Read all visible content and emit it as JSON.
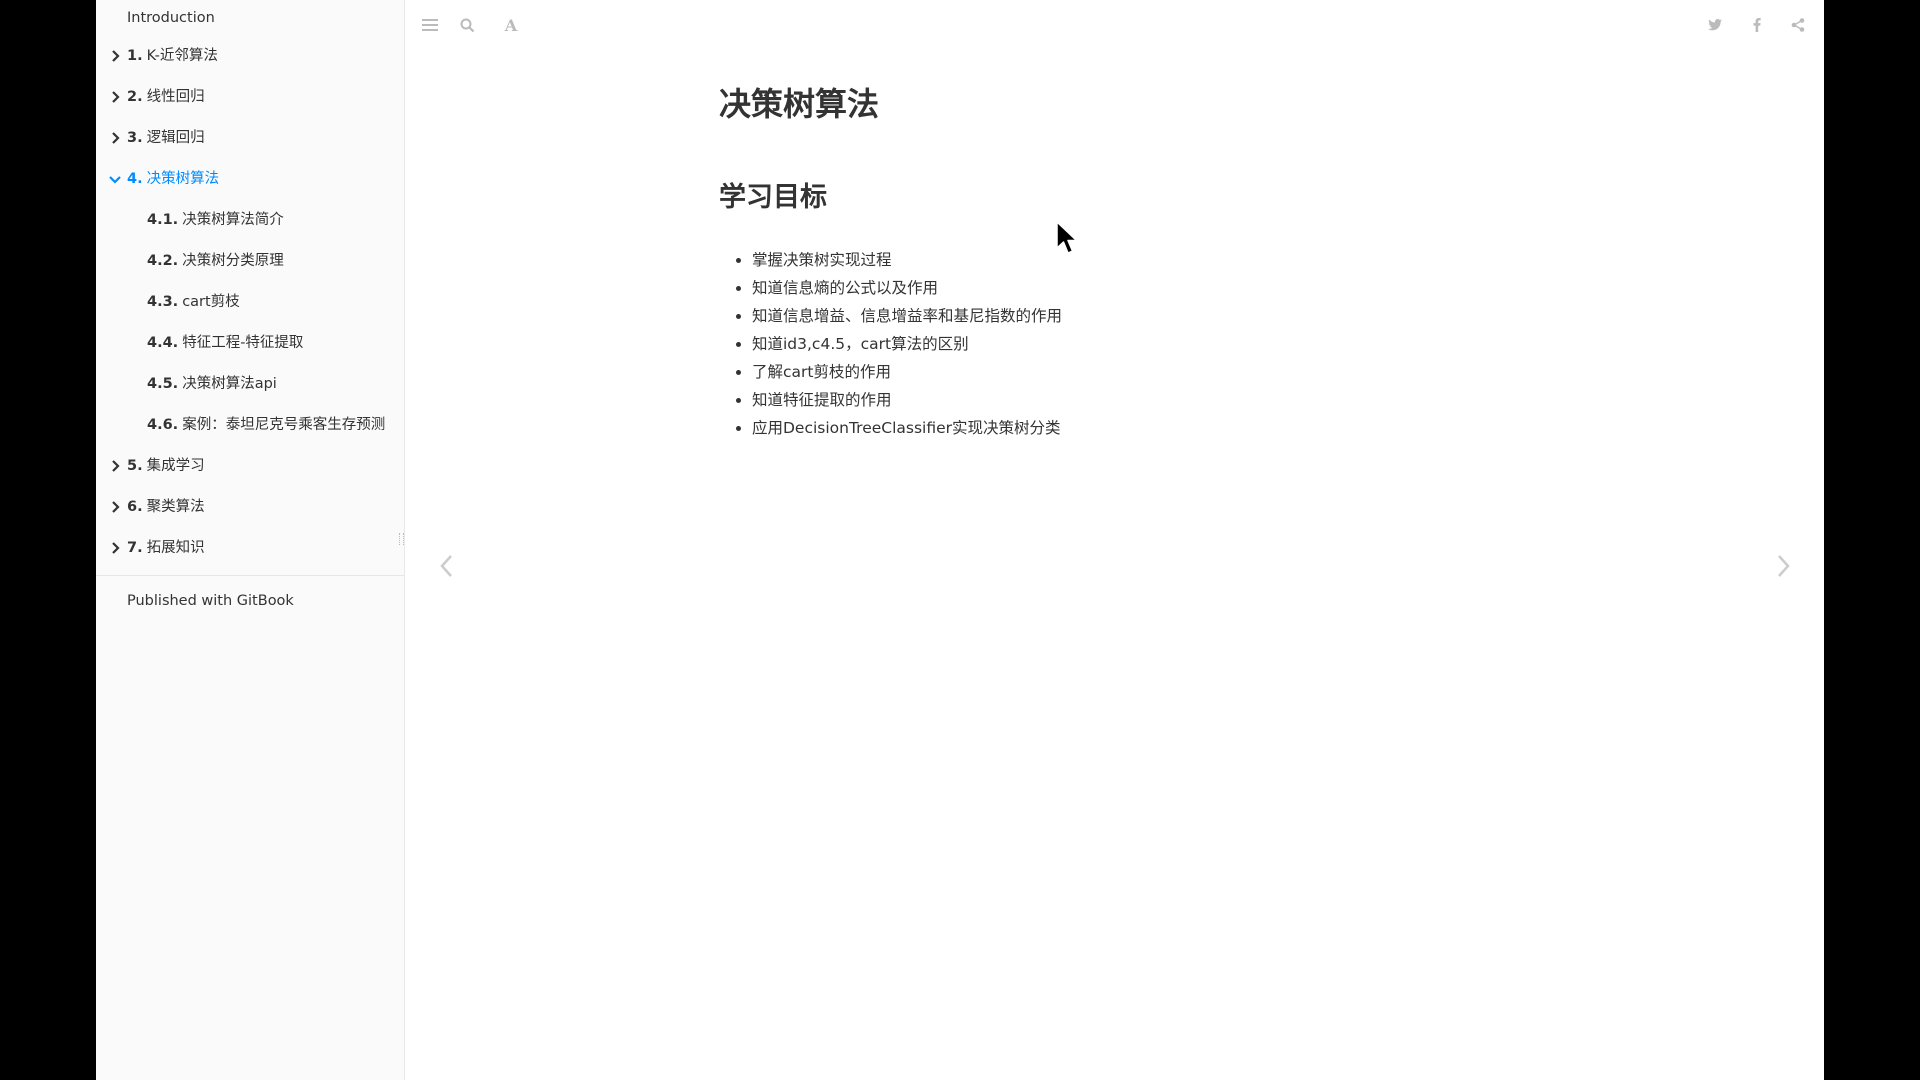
{
  "sidebar": {
    "intro": "Introduction",
    "chapters": [
      {
        "num": "1.",
        "label": "K-近邻算法"
      },
      {
        "num": "2.",
        "label": "线性回归"
      },
      {
        "num": "3.",
        "label": "逻辑回归"
      },
      {
        "num": "4.",
        "label": "决策树算法"
      },
      {
        "num": "5.",
        "label": "集成学习"
      },
      {
        "num": "6.",
        "label": "聚类算法"
      },
      {
        "num": "7.",
        "label": "拓展知识"
      }
    ],
    "sub_items": [
      {
        "num": "4.1.",
        "label": "决策树算法简介"
      },
      {
        "num": "4.2.",
        "label": "决策树分类原理"
      },
      {
        "num": "4.3.",
        "label": "cart剪枝"
      },
      {
        "num": "4.4.",
        "label": "特征工程-特征提取"
      },
      {
        "num": "4.5.",
        "label": "决策树算法api"
      },
      {
        "num": "4.6.",
        "label": "案例：泰坦尼克号乘客生存预测"
      }
    ],
    "published": "Published with GitBook",
    "active_color": "#008cff"
  },
  "toolbar": {
    "icons": [
      "menu-icon",
      "search-icon",
      "font-settings-icon",
      "twitter-icon",
      "facebook-icon",
      "share-icon"
    ]
  },
  "article": {
    "title": "决策树算法",
    "section_heading": "学习目标",
    "goals": [
      "掌握决策树实现过程",
      "知道信息熵的公式以及作用",
      "知道信息增益、信息增益率和基尼指数的作用",
      "知道id3,c4.5，cart算法的区别",
      "了解cart剪枝的作用",
      "知道特征提取的作用",
      "应用DecisionTreeClassifier实现决策树分类"
    ]
  }
}
